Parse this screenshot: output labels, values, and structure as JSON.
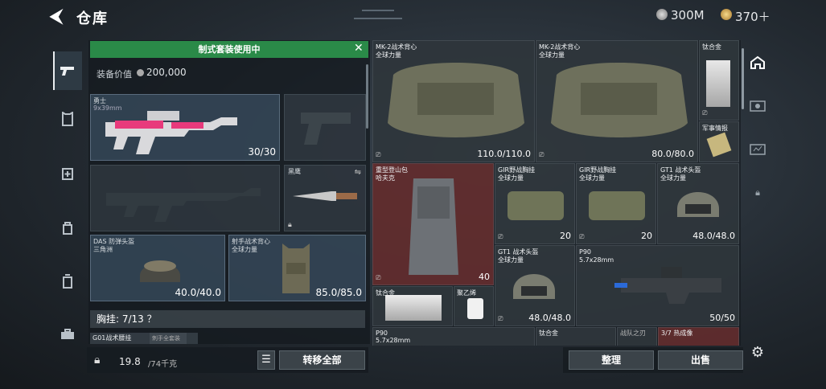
{
  "header": {
    "back_glyph": "⮜",
    "title": "仓库",
    "currency_a": "300M",
    "currency_b": "370＋"
  },
  "left_rail": {
    "icons": [
      "pistol-icon",
      "armor-icon",
      "medic-icon",
      "bag-icon",
      "ammo-box-icon",
      "toolbox-icon"
    ]
  },
  "loadout": {
    "banner": "制式套装使用中",
    "value_label": "装备价值",
    "value": "200,000",
    "primary": {
      "name": "勇士",
      "caliber": "9x39mm",
      "ammo": "30/30"
    },
    "melee": {
      "name": "黑鹰"
    },
    "helmet": {
      "name": "DAS 防弹头盔",
      "sub": "三角洲",
      "durability": "40.0/40.0"
    },
    "vest": {
      "name": "射手战术背心",
      "sub": "全球力量",
      "durability": "85.0/85.0"
    },
    "chest_rig": "胸挂: 7/13 ？",
    "chest_items": [
      "G01战术腰挂",
      "刺手全套装"
    ],
    "weight": "19.8",
    "weight_unit": "/74千克",
    "transfer_all": "转移全部"
  },
  "stash": {
    "items": [
      {
        "name": "MK-2战术背心",
        "sub": "全球力量",
        "value": "110.0/110.0"
      },
      {
        "name": "MK-2战术背心",
        "sub": "全球力量",
        "value": "80.0/80.0"
      },
      {
        "name": "钛合金",
        "sub": "",
        "value": ""
      },
      {
        "name": "军事情报",
        "sub": "",
        "value": ""
      },
      {
        "name": "重型登山包",
        "sub": "哈夫克",
        "value": "40"
      },
      {
        "name": "GIR野战胸挂",
        "sub": "全球力量",
        "value": "20"
      },
      {
        "name": "GIR野战胸挂",
        "sub": "全球力量",
        "value": "20"
      },
      {
        "name": "GT1 战术头盔",
        "sub": "全球力量",
        "value": "48.0/48.0"
      },
      {
        "name": "GT1 战术头盔",
        "sub": "全球力量",
        "value": "48.0/48.0"
      },
      {
        "name": "P90",
        "sub": "5.7x28mm",
        "value": "50/50"
      },
      {
        "name": "钛合金",
        "sub": "",
        "value": ""
      },
      {
        "name": "聚乙烯",
        "sub": "",
        "value": ""
      },
      {
        "name": "P90",
        "sub": "5.7x28mm",
        "value": ""
      },
      {
        "name": "钛合金",
        "sub": "",
        "value": ""
      },
      {
        "name": "战队之刃",
        "sub": "",
        "value": ""
      },
      {
        "name": "3/7 热成像",
        "sub": "",
        "value": ""
      }
    ],
    "sort": "整理",
    "sell": "出售"
  },
  "right_rail": {
    "icons": [
      "home-stash-icon",
      "weapon-case-icon",
      "chest-case-icon",
      "lock-icon",
      "gear-icon"
    ]
  },
  "colors": {
    "banner": "#2a8a48",
    "red_cell": "#6e3030"
  }
}
